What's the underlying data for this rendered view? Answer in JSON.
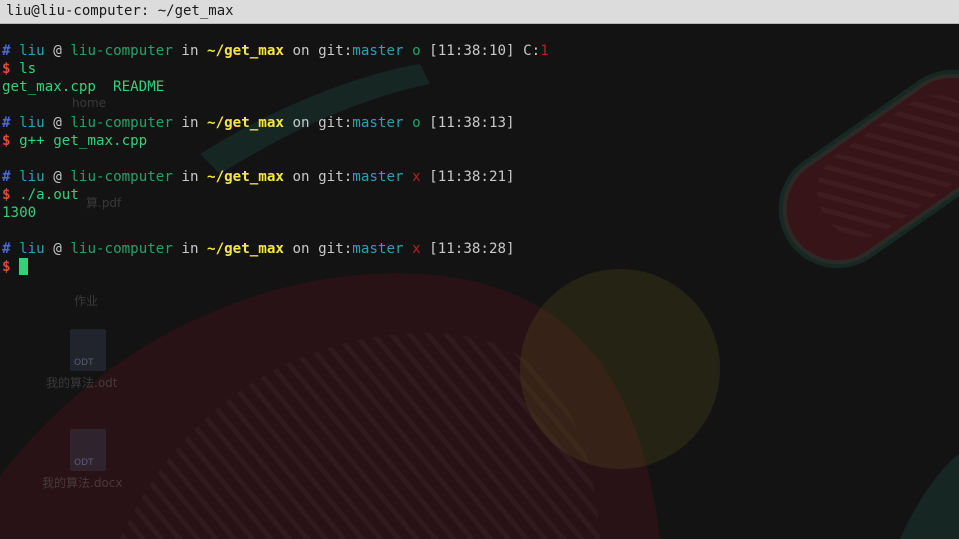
{
  "window": {
    "title": "liu@liu-computer: ~/get_max"
  },
  "colors": {
    "titlebar_bg": "#dcdcdc",
    "terminal_bg": "#131313",
    "hash": "#4b69d6",
    "user": "#2aa1b3",
    "host": "#26a269",
    "dir": "#f5e642",
    "branch": "#2aa1b3",
    "clean": "#26a269",
    "dirty": "#c01c28",
    "prompt_dollar": "#e0483a",
    "command": "#33d17a",
    "cursor": "#33d17a"
  },
  "prompt": {
    "hash": "#",
    "user": "liu",
    "at": "@",
    "host": "liu-computer",
    "in": "in",
    "dir": "~/get_max",
    "on": "on",
    "git_label": "git:",
    "branch": "master",
    "dollar": "$"
  },
  "blocks": [
    {
      "status": "o",
      "status_kind": "clean",
      "time": "[11:38:10]",
      "exit_label": "C:",
      "exit_code": "1",
      "command": "ls",
      "output": "get_max.cpp  README"
    },
    {
      "status": "o",
      "status_kind": "clean",
      "time": "[11:38:13]",
      "command": "g++ get_max.cpp"
    },
    {
      "status": "x",
      "status_kind": "dirty",
      "time": "[11:38:21]",
      "command": "./a.out",
      "output": "1300"
    },
    {
      "status": "x",
      "status_kind": "dirty",
      "time": "[11:38:28]"
    }
  ],
  "desktop_background": {
    "labels": [
      "home",
      "算.pdf",
      "作业",
      "ODT",
      "我的算法.odt",
      "ODT",
      "我的算法.docx"
    ]
  }
}
